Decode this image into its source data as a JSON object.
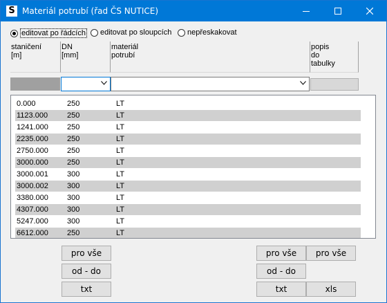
{
  "window": {
    "title": "Materiál potrubí (řad ČS NUTICE)",
    "icon_letter": "S"
  },
  "mode": {
    "options": [
      {
        "label": "editovat po řádcích",
        "checked": true
      },
      {
        "label": "editovat po sloupcích",
        "checked": false
      },
      {
        "label": "nepřeskakovat",
        "checked": false
      }
    ]
  },
  "columns": {
    "staniceni": "staničení\n[m]",
    "dn": "DN\n[mm]",
    "material": "materiál\npotrubí",
    "popis": "popis\ndo\ntabulky"
  },
  "rows": [
    {
      "staniceni": "0.000",
      "dn": "250",
      "material": "LT"
    },
    {
      "staniceni": "1123.000",
      "dn": "250",
      "material": "LT"
    },
    {
      "staniceni": "1241.000",
      "dn": "250",
      "material": "LT"
    },
    {
      "staniceni": "2235.000",
      "dn": "250",
      "material": "LT"
    },
    {
      "staniceni": "2750.000",
      "dn": "250",
      "material": "LT"
    },
    {
      "staniceni": "3000.000",
      "dn": "250",
      "material": "LT"
    },
    {
      "staniceni": "3000.001",
      "dn": "300",
      "material": "LT"
    },
    {
      "staniceni": "3000.002",
      "dn": "300",
      "material": "LT"
    },
    {
      "staniceni": "3380.000",
      "dn": "300",
      "material": "LT"
    },
    {
      "staniceni": "4307.000",
      "dn": "300",
      "material": "LT"
    },
    {
      "staniceni": "5247.000",
      "dn": "300",
      "material": "LT"
    },
    {
      "staniceni": "6612.000",
      "dn": "250",
      "material": "LT"
    }
  ],
  "buttons": {
    "left_pro_vse": "pro vše",
    "left_od_do": "od - do",
    "left_txt": "txt",
    "right_pro_vse_1": "pro vše",
    "right_pro_vse_2": "pro vše",
    "right_od_do": "od - do",
    "right_txt": "txt",
    "right_xls": "xls"
  },
  "colors": {
    "titlebar": "#0078d7",
    "row_alt": "#d0d0d0",
    "focus_border": "#0078d7"
  }
}
